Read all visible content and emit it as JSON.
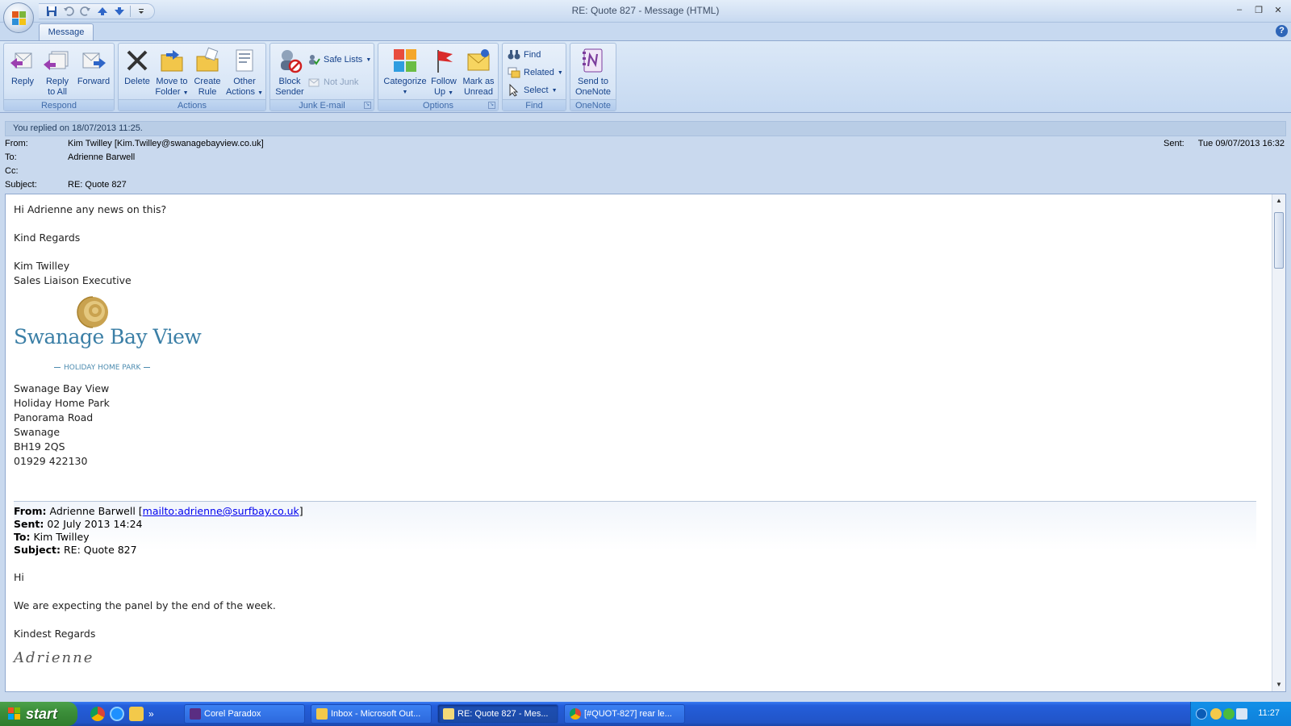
{
  "window": {
    "title": "RE: Quote 827  -  Message (HTML)",
    "minimize_glyph": "–",
    "maximize_glyph": "❐",
    "close_glyph": "✕"
  },
  "ribbon": {
    "tab": "Message",
    "help_glyph": "?",
    "groups": {
      "respond": {
        "label": "Respond",
        "reply": "Reply",
        "reply_all_1": "Reply",
        "reply_all_2": "to All",
        "forward": "Forward"
      },
      "actions": {
        "label": "Actions",
        "delete": "Delete",
        "move_1": "Move to",
        "move_2": "Folder",
        "create_1": "Create",
        "create_2": "Rule",
        "other_1": "Other",
        "other_2": "Actions"
      },
      "junk": {
        "label": "Junk E-mail",
        "block_1": "Block",
        "block_2": "Sender",
        "safe_lists": "Safe Lists",
        "not_junk": "Not Junk"
      },
      "options": {
        "label": "Options",
        "categorize": "Categorize",
        "follow_1": "Follow",
        "follow_2": "Up",
        "mark_1": "Mark as",
        "mark_2": "Unread"
      },
      "find": {
        "label": "Find",
        "find": "Find",
        "related": "Related",
        "select": "Select"
      },
      "onenote": {
        "label": "OneNote",
        "send_1": "Send to",
        "send_2": "OneNote"
      }
    }
  },
  "header": {
    "info_bar": "You replied on 18/07/2013 11:25.",
    "from_label": "From:",
    "from_value": "Kim Twilley [Kim.Twilley@swanagebayview.co.uk]",
    "to_label": "To:",
    "to_value": "Adrienne Barwell",
    "cc_label": "Cc:",
    "cc_value": "",
    "subject_label": "Subject:",
    "subject_value": "RE: Quote 827",
    "sent_label": "Sent:",
    "sent_value": "Tue 09/07/2013 16:32"
  },
  "body": {
    "greeting": "Hi Adrienne any news on this?",
    "regards": "Kind Regards",
    "sig_name": "Kim Twilley",
    "sig_title": "Sales Liaison Executive",
    "logo_text": "Swanage Bay View",
    "logo_sub": "HOLIDAY HOME PARK",
    "address": [
      "Swanage Bay View",
      "Holiday Home Park",
      "Panorama Road",
      "Swanage",
      "BH19 2QS",
      "01929 422130"
    ],
    "quoted": {
      "from_label": "From:",
      "from_name": "Adrienne Barwell [",
      "from_link": "mailto:adrienne@surfbay.co.uk",
      "from_close": "]",
      "sent_label": "Sent:",
      "sent_value": "02 July 2013 14:24",
      "to_label": "To:",
      "to_value": "Kim Twilley",
      "subject_label": "Subject:",
      "subject_value": "RE: Quote 827",
      "line1": "Hi",
      "line2": "We are expecting the panel by the end of the week.",
      "line3": "Kindest Regards",
      "signature": "Adrienne"
    }
  },
  "taskbar": {
    "start": "start",
    "more_glyph": "»",
    "tasks": [
      {
        "label": "Corel Paradox"
      },
      {
        "label": "Inbox - Microsoft Out..."
      },
      {
        "label": "RE: Quote 827 - Mes..."
      },
      {
        "label": "[#QUOT-827] rear le..."
      }
    ],
    "clock": "11:27"
  },
  "colors": {
    "ribbon_text": "#15428b",
    "taskbar_blue": "#245edb",
    "start_green": "#3c8f3a",
    "logo_teal": "#3b7fa6",
    "logo_gold": "#b08c3a"
  }
}
